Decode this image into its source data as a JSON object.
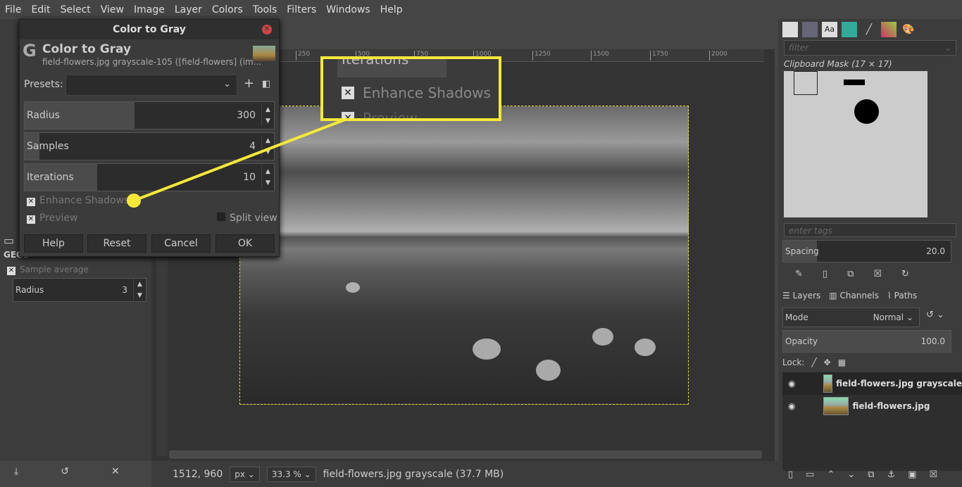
{
  "menu": [
    "File",
    "Edit",
    "Select",
    "View",
    "Image",
    "Layer",
    "Colors",
    "Tools",
    "Filters",
    "Windows",
    "Help"
  ],
  "ruler": [
    "250",
    "500",
    "750",
    "1000",
    "1250",
    "1500",
    "1750",
    "2000"
  ],
  "dialog": {
    "window_title": "Color to Gray",
    "header_title": "Color to Gray",
    "subtitle": "field-flowers.jpg grayscale-105 ([field-flowers] (im...",
    "presets_label": "Presets:",
    "presets_value": "",
    "radius_label": "Radius",
    "radius_value": "300",
    "samples_label": "Samples",
    "samples_value": "4",
    "iterations_label": "Iterations",
    "iterations_value": "10",
    "enhance_shadows": "Enhance Shadows",
    "preview": "Preview",
    "split_view": "Split view",
    "buttons": {
      "help": "Help",
      "reset": "Reset",
      "cancel": "Cancel",
      "ok": "OK"
    }
  },
  "callout": {
    "iterations": "Iterations",
    "enhance_shadows": "Enhance Shadows",
    "preview": "Preview",
    "color": "#f5e83a"
  },
  "tool_options": {
    "title": "GEGL",
    "sample_average": "Sample average",
    "radius_label": "Radius",
    "radius_value": "3"
  },
  "status": {
    "coords": "1512, 960",
    "unit": "px",
    "zoom": "33.3 %",
    "info": "field-flowers.jpg grayscale (37.7 MB)"
  },
  "brushes": {
    "filter_placeholder": "filter",
    "brush_name": "Clipboard Mask (17 × 17)",
    "tags_placeholder": "enter tags",
    "spacing_label": "Spacing",
    "spacing_value": "20.0"
  },
  "layers": {
    "tabs": [
      "Layers",
      "Channels",
      "Paths"
    ],
    "mode_label": "Mode",
    "mode_value": "Normal",
    "opacity_label": "Opacity",
    "opacity_value": "100.0",
    "lock_label": "Lock:",
    "items": [
      {
        "name": "field-flowers.jpg grayscale",
        "visible": true
      },
      {
        "name": "field-flowers.jpg",
        "visible": true
      }
    ]
  }
}
